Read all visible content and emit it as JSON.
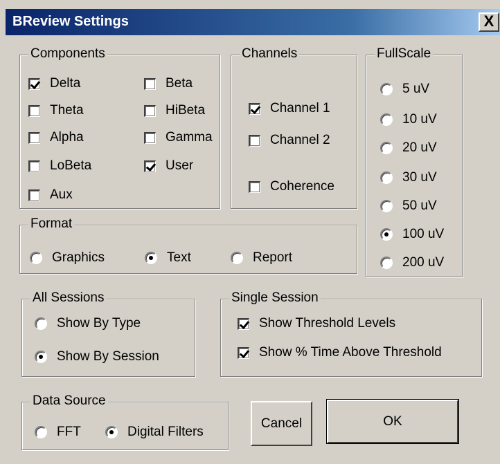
{
  "window": {
    "title": "BReview Settings",
    "close_glyph": "X"
  },
  "components": {
    "legend": "Components",
    "items": [
      {
        "label": "Delta",
        "checked": true
      },
      {
        "label": "Theta",
        "checked": false
      },
      {
        "label": "Alpha",
        "checked": false
      },
      {
        "label": "LoBeta",
        "checked": false
      },
      {
        "label": "Aux",
        "checked": false
      },
      {
        "label": "Beta",
        "checked": false
      },
      {
        "label": "HiBeta",
        "checked": false
      },
      {
        "label": "Gamma",
        "checked": false
      },
      {
        "label": "User",
        "checked": true
      }
    ]
  },
  "channels": {
    "legend": "Channels",
    "items": [
      {
        "label": "Channel 1",
        "checked": true
      },
      {
        "label": "Channel 2",
        "checked": false
      },
      {
        "label": "Coherence",
        "checked": false
      }
    ]
  },
  "fullscale": {
    "legend": "FullScale",
    "selected": "100 uV",
    "options": [
      "5 uV",
      "10 uV",
      "20 uV",
      "30 uV",
      "50 uV",
      "100 uV",
      "200 uV"
    ]
  },
  "format": {
    "legend": "Format",
    "selected": "Text",
    "options": [
      "Graphics",
      "Text",
      "Report"
    ]
  },
  "all_sessions": {
    "legend": "All Sessions",
    "selected": "Show By Session",
    "options": [
      "Show By Type",
      "Show By Session"
    ]
  },
  "single_session": {
    "legend": "Single Session",
    "items": [
      {
        "label": "Show Threshold Levels",
        "checked": true
      },
      {
        "label": "Show % Time Above Threshold",
        "checked": true
      }
    ]
  },
  "data_source": {
    "legend": "Data Source",
    "selected": "Digital Filters",
    "options": [
      "FFT",
      "Digital Filters"
    ]
  },
  "buttons": {
    "cancel": "Cancel",
    "ok": "OK"
  }
}
